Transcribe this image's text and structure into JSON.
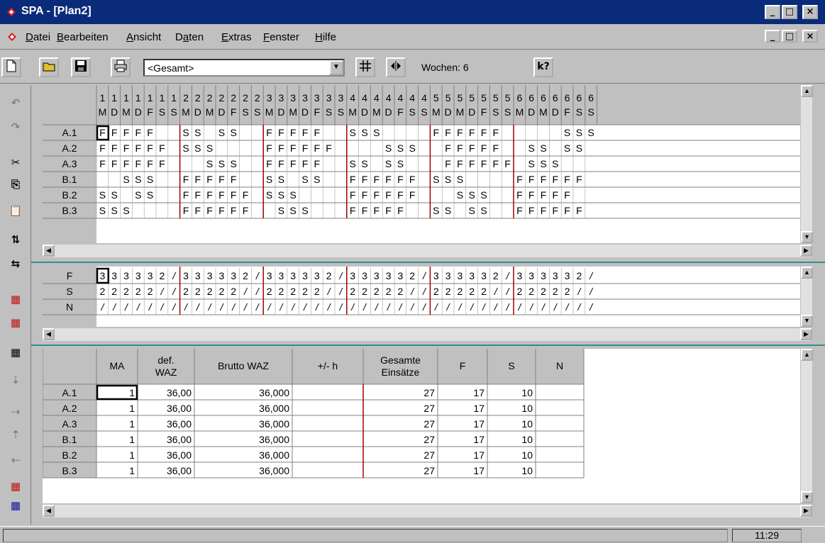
{
  "window": {
    "title": "SPA - [Plan2]",
    "min": "_",
    "max": "□",
    "close": "×",
    "restore": "ꟷ"
  },
  "menu": [
    {
      "label": "Datei",
      "ul": "D"
    },
    {
      "label": "Bearbeiten",
      "ul": "B"
    },
    {
      "label": "Ansicht",
      "ul": "A"
    },
    {
      "label": "Daten",
      "ul": "a"
    },
    {
      "label": "Extras",
      "ul": "E"
    },
    {
      "label": "Fenster",
      "ul": "F"
    },
    {
      "label": "Hilfe",
      "ul": "H"
    }
  ],
  "toolbar": {
    "combo_value": "<Gesamt>",
    "weeks_label": "Wochen: 6",
    "help_icon": "k?"
  },
  "plan": {
    "days": [
      "M",
      "D",
      "M",
      "D",
      "F",
      "S",
      "S"
    ],
    "weeks": [
      1,
      2,
      3,
      4,
      5,
      6
    ],
    "rows": [
      {
        "label": "A.1",
        "cells": "FFFFF  SS SS  FFFFF  SSS    FFFFFF     SSS "
      },
      {
        "label": "A.2",
        "cells": "FFFFFF SSS    FFFFFF    SSS  FFFFF  SS SS "
      },
      {
        "label": "A.3",
        "cells": "FFFFFF   SSS  FFFFF  SS SS   FFFFFF SSS    "
      },
      {
        "label": "B.1",
        "cells": "  SSS  FFFFF  SS SS  FFFFFF SSS    FFFFFF "
      },
      {
        "label": "B.2",
        "cells": "SS SS  FFFFFF SSS    FFFFFF   SSS  FFFFF  "
      },
      {
        "label": "B.3",
        "cells": "SSS    FFFFFF  SSS   FFFFF  SS SS  FFFFFF "
      }
    ]
  },
  "summary": {
    "rows": [
      {
        "label": "F",
        "cells": [
          "3",
          "3",
          "3",
          "3",
          "3",
          "2",
          "/",
          "3",
          "3",
          "3",
          "3",
          "3",
          "2",
          "/",
          "3",
          "3",
          "3",
          "3",
          "3",
          "2",
          "/",
          "3",
          "3",
          "3",
          "3",
          "3",
          "2",
          "/",
          "3",
          "3",
          "3",
          "3",
          "3",
          "2",
          "/",
          "3",
          "3",
          "3",
          "3",
          "3",
          "2",
          "/"
        ]
      },
      {
        "label": "S",
        "cells": [
          "2",
          "2",
          "2",
          "2",
          "2",
          "/",
          "/",
          "2",
          "2",
          "2",
          "2",
          "2",
          "/",
          "/",
          "2",
          "2",
          "2",
          "2",
          "2",
          "/",
          "/",
          "2",
          "2",
          "2",
          "2",
          "2",
          "/",
          "/",
          "2",
          "2",
          "2",
          "2",
          "2",
          "/",
          "/",
          "2",
          "2",
          "2",
          "2",
          "2",
          "/",
          "/"
        ]
      },
      {
        "label": "N",
        "cells": [
          "/",
          "/",
          "/",
          "/",
          "/",
          "/",
          "/",
          "/",
          "/",
          "/",
          "/",
          "/",
          "/",
          "/",
          "/",
          "/",
          "/",
          "/",
          "/",
          "/",
          "/",
          "/",
          "/",
          "/",
          "/",
          "/",
          "/",
          "/",
          "/",
          "/",
          "/",
          "/",
          "/",
          "/",
          "/",
          "/",
          "/",
          "/",
          "/",
          "/",
          "/",
          "/"
        ]
      }
    ]
  },
  "stats": {
    "headers": [
      "MA",
      "def.\nWAZ",
      "Brutto WAZ",
      "+/- h",
      "Gesamte\nEinsätze",
      "F",
      "S",
      "N"
    ],
    "rows": [
      {
        "label": "A.1",
        "values": [
          "1",
          "36,00",
          "36,000",
          "",
          "27",
          "17",
          "10",
          ""
        ]
      },
      {
        "label": "A.2",
        "values": [
          "1",
          "36,00",
          "36,000",
          "",
          "27",
          "17",
          "10",
          ""
        ]
      },
      {
        "label": "A.3",
        "values": [
          "1",
          "36,00",
          "36,000",
          "",
          "27",
          "17",
          "10",
          ""
        ]
      },
      {
        "label": "B.1",
        "values": [
          "1",
          "36,00",
          "36,000",
          "",
          "27",
          "17",
          "10",
          ""
        ]
      },
      {
        "label": "B.2",
        "values": [
          "1",
          "36,00",
          "36,000",
          "",
          "27",
          "17",
          "10",
          ""
        ]
      },
      {
        "label": "B.3",
        "values": [
          "1",
          "36,00",
          "36,000",
          "",
          "27",
          "17",
          "10",
          ""
        ]
      }
    ]
  },
  "status": {
    "time": "11:29"
  },
  "colors": {
    "title_bg": "#0a2a7a",
    "week_divider": "#a00000",
    "separator": "#2f8f8f"
  }
}
